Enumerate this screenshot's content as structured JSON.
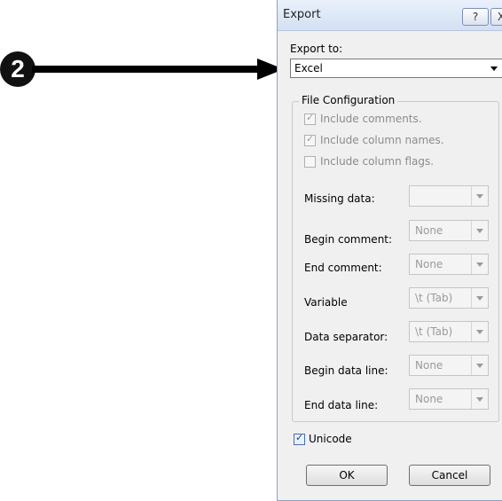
{
  "callout": {
    "number": "2"
  },
  "dialog": {
    "title": "Export",
    "help_label": "?",
    "close_label": "X",
    "export_to_label": "Export to:",
    "export_to_value": "Excel",
    "file_config": {
      "title": "File Configuration",
      "checkboxes": [
        {
          "label": "Include comments.",
          "checked": true
        },
        {
          "label": "Include column names.",
          "checked": true
        },
        {
          "label": "Include column flags.",
          "checked": false
        }
      ],
      "rows": [
        {
          "label": "Missing data:",
          "value": ""
        },
        {
          "label": "Begin comment:",
          "value": "None"
        },
        {
          "label": "End comment:",
          "value": "None"
        },
        {
          "label": "Variable",
          "value": "\\t (Tab)"
        },
        {
          "label": "Data separator:",
          "value": "\\t (Tab)"
        },
        {
          "label": "Begin data line:",
          "value": "None"
        },
        {
          "label": "End data line:",
          "value": "None"
        }
      ]
    },
    "unicode": {
      "label": "Unicode",
      "checked": true
    },
    "ok_label": "OK",
    "cancel_label": "Cancel"
  }
}
